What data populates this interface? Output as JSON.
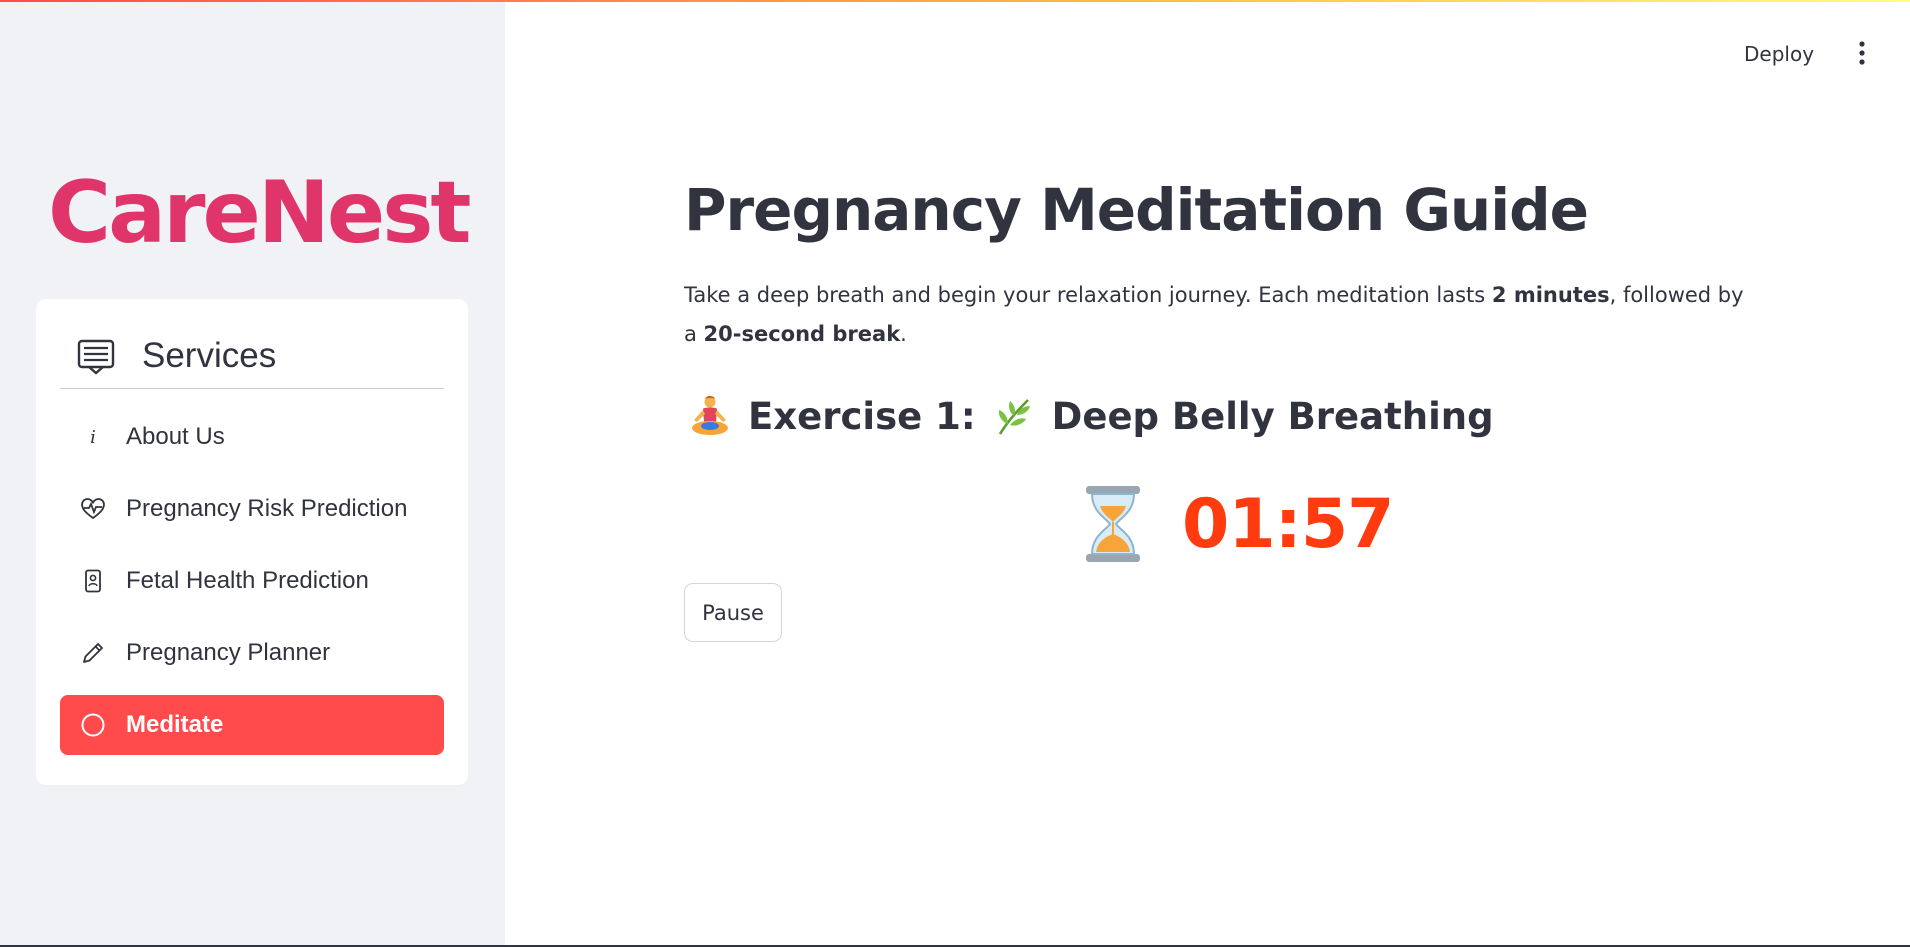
{
  "colors": {
    "brand": "#e0356a",
    "accent": "#ff4b4b",
    "timer": "#ff3b0f",
    "text": "#31333f",
    "sidebar_bg": "#f0f2f6"
  },
  "sidebar": {
    "brand": "CareNest",
    "menu_title": "Services",
    "menu_icon": "list-box-icon",
    "items": [
      {
        "label": "About Us",
        "icon": "info-icon",
        "active": false
      },
      {
        "label": "Pregnancy Risk Prediction",
        "icon": "heart-pulse-icon",
        "active": false
      },
      {
        "label": "Fetal Health Prediction",
        "icon": "person-badge-icon",
        "active": false
      },
      {
        "label": "Pregnancy Planner",
        "icon": "pencil-icon",
        "active": false
      },
      {
        "label": "Meditate",
        "icon": "circle-icon",
        "active": true
      }
    ]
  },
  "toolbar": {
    "deploy_label": "Deploy",
    "menu_icon": "kebab-menu-icon"
  },
  "main": {
    "title": "Pregnancy Meditation Guide",
    "intro": {
      "part1": "Take a deep breath and begin your relaxation journey. Each meditation lasts ",
      "bold1": "2 minutes",
      "part2": ", followed by a ",
      "bold2": "20-second break",
      "part3": "."
    },
    "exercise": {
      "prefix": "Exercise 1:",
      "name": "Deep Belly Breathing",
      "lead_icon": "meditating-person-icon",
      "name_icon": "herb-icon"
    },
    "timer": {
      "icon": "hourglass-icon",
      "value": "01:57"
    },
    "pause_label": "Pause"
  }
}
